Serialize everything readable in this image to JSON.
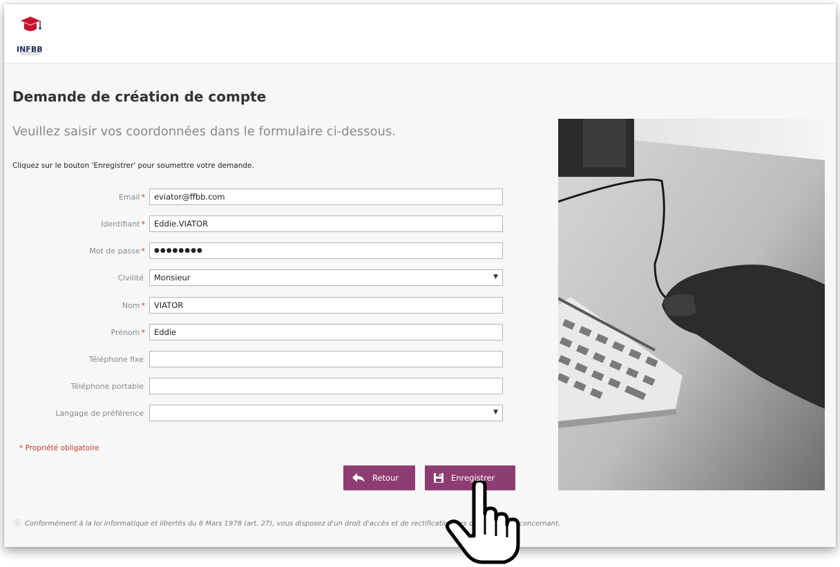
{
  "header": {
    "logo_text": "INFBB"
  },
  "page": {
    "title": "Demande de création de compte",
    "subtitle": "Veuillez saisir vos coordonnées dans le formulaire ci-dessous.",
    "instruction": "Cliquez sur le bouton 'Enregistrer' pour soumettre votre demande."
  },
  "form": {
    "fields": [
      {
        "label": "Email",
        "required": "*",
        "value": "eviator@ffbb.com",
        "type": "text"
      },
      {
        "label": "Identifiant",
        "required": "*",
        "value": "Eddie.VIATOR",
        "type": "text"
      },
      {
        "label": "Mot de passe",
        "required": "*",
        "value": "●●●●●●●●",
        "type": "password"
      },
      {
        "label": "Civilité",
        "required": "",
        "value": "Monsieur",
        "type": "select"
      },
      {
        "label": "Nom",
        "required": "*",
        "value": "VIATOR",
        "type": "text"
      },
      {
        "label": "Prénom",
        "required": "*",
        "value": "Eddie",
        "type": "text"
      },
      {
        "label": "Téléphone fixe",
        "required": "",
        "value": "",
        "type": "text"
      },
      {
        "label": "Téléphone portable",
        "required": "",
        "value": "",
        "type": "text"
      },
      {
        "label": "Langage de préférence",
        "required": "",
        "value": "",
        "type": "select"
      }
    ],
    "required_note": "* Propriété obligatoire",
    "back_label": "Retour",
    "save_label": "Enregistrer"
  },
  "footer": {
    "note": "Conformément à la loi informatique et libertés du 6 Mars 1978 (art. 27), vous disposez d'un droit d'accès et de rectification des données vous concernant."
  },
  "colors": {
    "button": "#8e3d72",
    "required": "#c0392b",
    "logo_red": "#c8102e",
    "logo_blue": "#1b2d5b"
  },
  "icons": {
    "back": "reply-arrow-icon",
    "save": "floppy-disk-icon",
    "info": "info-icon",
    "cursor": "hand-pointer-icon"
  }
}
